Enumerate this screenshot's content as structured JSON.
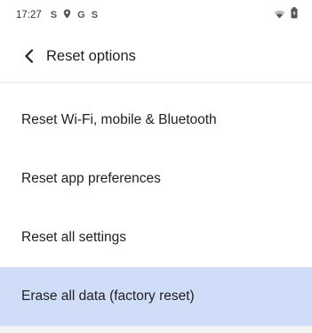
{
  "status_bar": {
    "time": "17:27",
    "left_icons": [
      "S",
      "G",
      "S"
    ],
    "icon_names": [
      "skype-notification-icon",
      "location-icon",
      "google-icon",
      "skype-notification-icon",
      "wifi-icon",
      "battery-charging-icon"
    ]
  },
  "header": {
    "title": "Reset options"
  },
  "options": [
    {
      "label": "Reset Wi-Fi, mobile & Bluetooth"
    },
    {
      "label": "Reset app preferences"
    },
    {
      "label": "Reset all settings"
    },
    {
      "label": "Erase all data (factory reset)",
      "selected": true
    }
  ],
  "colors": {
    "selected_background": "#cfddf8",
    "text": "#1f1f1f",
    "divider": "#e6e6e6"
  }
}
